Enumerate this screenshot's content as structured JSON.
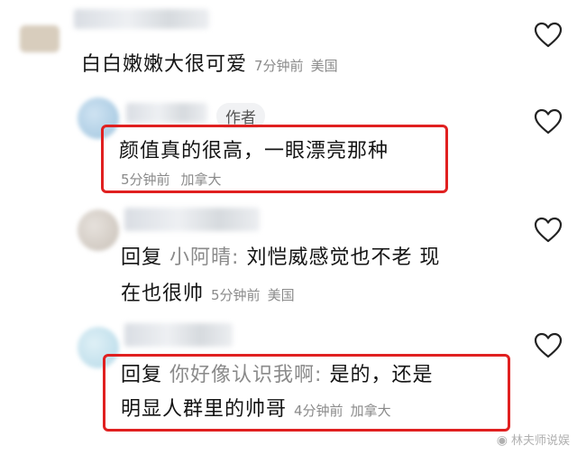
{
  "comments": [
    {
      "text": "白白嫩嫩大很可爱",
      "time": "7分钟前",
      "location": "美国"
    },
    {
      "badge": "作者",
      "text": "颜值真的很高，一眼漂亮那种",
      "time": "5分钟前",
      "location": "加拿大"
    },
    {
      "reply_prefix": "回复",
      "reply_target": "小阿晴:",
      "text_line1": "刘恺威感觉也不老 现",
      "text_line2": "在也很帅",
      "time": "5分钟前",
      "location": "美国"
    },
    {
      "reply_prefix": "回复",
      "reply_target": "你好像认识我啊:",
      "text_line1": "是的，还是",
      "text_line2": "明显人群里的帅哥",
      "time": "4分钟前",
      "location": "加拿大"
    }
  ],
  "watermark": {
    "logo_icon": "weibo-icon",
    "text": "林夫师说娱"
  },
  "colors": {
    "highlight_box": "#e02020",
    "meta_text": "#8a8a8a"
  }
}
